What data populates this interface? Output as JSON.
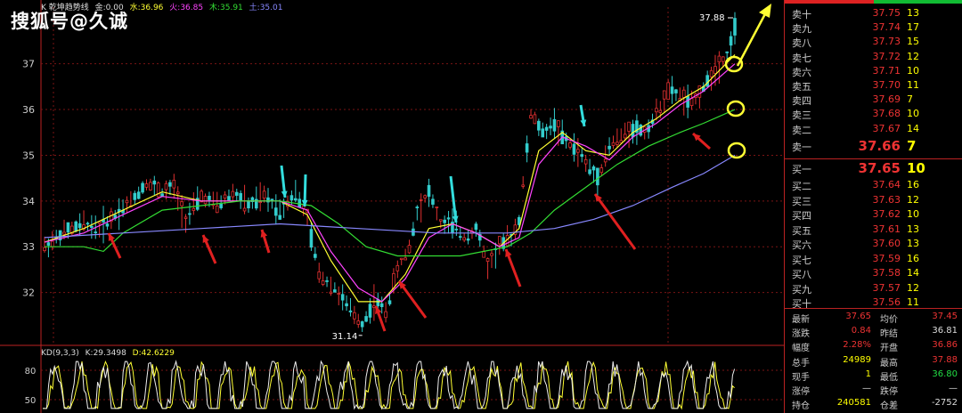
{
  "watermark": "搜狐号@久诚",
  "legend": {
    "title": "K 乾坤趋势线",
    "items": [
      {
        "text": "金:0.00",
        "color": "#dddddd"
      },
      {
        "text": "水:36.96",
        "color": "#ffff33"
      },
      {
        "text": "火:36.85",
        "color": "#ff44ff"
      },
      {
        "text": "木:35.91",
        "color": "#33dd33"
      },
      {
        "text": "土:35.01",
        "color": "#8888ff"
      }
    ]
  },
  "kd": {
    "title": "KD(9,3,3)",
    "k": "K:29.3498",
    "d": "D:42.6229"
  },
  "chart_data": {
    "type": "line",
    "title": "乾坤趋势线",
    "ylim": [
      31.0,
      38.2
    ],
    "yticks": [
      32,
      33,
      34,
      35,
      36,
      37
    ],
    "high_label": "37.88",
    "low_label": "31.14",
    "price": [
      [
        0,
        33.0
      ],
      [
        5,
        33.3
      ],
      [
        10,
        33.5
      ],
      [
        14,
        33.4
      ],
      [
        18,
        33.7
      ],
      [
        22,
        34.0
      ],
      [
        26,
        34.4
      ],
      [
        30,
        34.2
      ],
      [
        33,
        34.3
      ],
      [
        36,
        33.6
      ],
      [
        40,
        34.1
      ],
      [
        44,
        33.9
      ],
      [
        48,
        34.2
      ],
      [
        52,
        33.9
      ],
      [
        56,
        34.1
      ],
      [
        60,
        33.8
      ],
      [
        64,
        34.2
      ],
      [
        67,
        33.6
      ],
      [
        70,
        32.4
      ],
      [
        74,
        32.1
      ],
      [
        78,
        31.6
      ],
      [
        81,
        31.3
      ],
      [
        84,
        31.8
      ],
      [
        87,
        31.6
      ],
      [
        90,
        32.5
      ],
      [
        93,
        33.0
      ],
      [
        95,
        33.8
      ],
      [
        98,
        34.2
      ],
      [
        101,
        33.5
      ],
      [
        104,
        33.5
      ],
      [
        107,
        33.2
      ],
      [
        110,
        33.4
      ],
      [
        113,
        32.6
      ],
      [
        116,
        33.0
      ],
      [
        119,
        33.2
      ],
      [
        121,
        33.6
      ],
      [
        124,
        35.9
      ],
      [
        127,
        35.5
      ],
      [
        130,
        35.7
      ],
      [
        133,
        35.3
      ],
      [
        136,
        35.1
      ],
      [
        139,
        34.7
      ],
      [
        141,
        34.5
      ],
      [
        144,
        35.2
      ],
      [
        147,
        35.4
      ],
      [
        150,
        35.6
      ],
      [
        153,
        35.5
      ],
      [
        156,
        35.9
      ],
      [
        159,
        36.4
      ],
      [
        162,
        36.3
      ],
      [
        165,
        36.1
      ],
      [
        168,
        36.5
      ],
      [
        171,
        36.9
      ],
      [
        174,
        37.2
      ],
      [
        176,
        37.8
      ]
    ],
    "series": [
      {
        "name": "水",
        "color": "#ffff33",
        "values": [
          [
            0,
            33.1
          ],
          [
            10,
            33.4
          ],
          [
            20,
            33.8
          ],
          [
            30,
            34.2
          ],
          [
            40,
            34.0
          ],
          [
            50,
            34.0
          ],
          [
            60,
            34.0
          ],
          [
            67,
            33.7
          ],
          [
            73,
            32.7
          ],
          [
            80,
            31.8
          ],
          [
            86,
            31.8
          ],
          [
            92,
            32.4
          ],
          [
            98,
            33.4
          ],
          [
            104,
            33.5
          ],
          [
            110,
            33.3
          ],
          [
            116,
            33.0
          ],
          [
            121,
            33.4
          ],
          [
            126,
            35.1
          ],
          [
            132,
            35.5
          ],
          [
            138,
            35.1
          ],
          [
            144,
            35.0
          ],
          [
            150,
            35.5
          ],
          [
            156,
            35.8
          ],
          [
            162,
            36.2
          ],
          [
            168,
            36.5
          ],
          [
            176,
            37.2
          ]
        ]
      },
      {
        "name": "火",
        "color": "#ff44ff",
        "values": [
          [
            0,
            33.1
          ],
          [
            10,
            33.3
          ],
          [
            20,
            33.7
          ],
          [
            30,
            34.1
          ],
          [
            40,
            34.0
          ],
          [
            50,
            34.0
          ],
          [
            60,
            34.0
          ],
          [
            67,
            33.8
          ],
          [
            73,
            32.9
          ],
          [
            80,
            32.1
          ],
          [
            86,
            31.8
          ],
          [
            92,
            32.3
          ],
          [
            98,
            33.2
          ],
          [
            104,
            33.5
          ],
          [
            110,
            33.3
          ],
          [
            116,
            33.0
          ],
          [
            121,
            33.2
          ],
          [
            126,
            34.8
          ],
          [
            132,
            35.4
          ],
          [
            138,
            35.2
          ],
          [
            144,
            34.9
          ],
          [
            150,
            35.4
          ],
          [
            156,
            35.7
          ],
          [
            162,
            36.1
          ],
          [
            168,
            36.4
          ],
          [
            176,
            37.0
          ]
        ]
      },
      {
        "name": "木",
        "color": "#33dd33",
        "values": [
          [
            0,
            33.0
          ],
          [
            10,
            33.0
          ],
          [
            15,
            32.9
          ],
          [
            20,
            33.3
          ],
          [
            30,
            33.8
          ],
          [
            40,
            33.9
          ],
          [
            50,
            34.0
          ],
          [
            60,
            34.0
          ],
          [
            68,
            33.9
          ],
          [
            75,
            33.5
          ],
          [
            82,
            33.0
          ],
          [
            90,
            32.8
          ],
          [
            98,
            32.8
          ],
          [
            106,
            32.8
          ],
          [
            112,
            32.9
          ],
          [
            118,
            33.0
          ],
          [
            124,
            33.3
          ],
          [
            130,
            33.8
          ],
          [
            138,
            34.3
          ],
          [
            146,
            34.8
          ],
          [
            154,
            35.2
          ],
          [
            162,
            35.5
          ],
          [
            168,
            35.7
          ],
          [
            176,
            36.0
          ]
        ]
      },
      {
        "name": "土",
        "color": "#8888ff",
        "values": [
          [
            0,
            33.2
          ],
          [
            20,
            33.3
          ],
          [
            40,
            33.4
          ],
          [
            60,
            33.5
          ],
          [
            80,
            33.4
          ],
          [
            100,
            33.3
          ],
          [
            118,
            33.3
          ],
          [
            130,
            33.4
          ],
          [
            140,
            33.6
          ],
          [
            150,
            33.9
          ],
          [
            160,
            34.3
          ],
          [
            168,
            34.6
          ],
          [
            176,
            35.0
          ]
        ]
      }
    ],
    "kd_ylim": [
      40,
      90
    ],
    "kd_yticks": [
      50,
      80
    ]
  },
  "orderbook": {
    "asks": [
      {
        "label": "卖十",
        "price": "37.75",
        "vol": "13"
      },
      {
        "label": "卖九",
        "price": "37.74",
        "vol": "17"
      },
      {
        "label": "卖八",
        "price": "37.73",
        "vol": "15"
      },
      {
        "label": "卖七",
        "price": "37.72",
        "vol": "12"
      },
      {
        "label": "卖六",
        "price": "37.71",
        "vol": "10"
      },
      {
        "label": "卖五",
        "price": "37.70",
        "vol": "11"
      },
      {
        "label": "卖四",
        "price": "37.69",
        "vol": "7"
      },
      {
        "label": "卖三",
        "price": "37.68",
        "vol": "10"
      },
      {
        "label": "卖二",
        "price": "37.67",
        "vol": "14"
      },
      {
        "label": "卖一",
        "price": "37.66",
        "vol": "7"
      }
    ],
    "bids": [
      {
        "label": "买一",
        "price": "37.65",
        "vol": "10"
      },
      {
        "label": "买二",
        "price": "37.64",
        "vol": "16"
      },
      {
        "label": "买三",
        "price": "37.63",
        "vol": "12"
      },
      {
        "label": "买四",
        "price": "37.62",
        "vol": "10"
      },
      {
        "label": "买五",
        "price": "37.61",
        "vol": "13"
      },
      {
        "label": "买六",
        "price": "37.60",
        "vol": "13"
      },
      {
        "label": "买七",
        "price": "37.59",
        "vol": "16"
      },
      {
        "label": "买八",
        "price": "37.58",
        "vol": "14"
      },
      {
        "label": "买九",
        "price": "37.57",
        "vol": "12"
      },
      {
        "label": "买十",
        "price": "37.56",
        "vol": "11"
      }
    ]
  },
  "stats": [
    {
      "l1": "最新",
      "v1": "37.65",
      "c1": "red",
      "l2": "均价",
      "v2": "37.45",
      "c2": "red"
    },
    {
      "l1": "涨跌",
      "v1": "0.84",
      "c1": "red",
      "l2": "昨结",
      "v2": "36.81",
      "c2": "wht"
    },
    {
      "l1": "幅度",
      "v1": "2.28%",
      "c1": "red",
      "l2": "开盘",
      "v2": "36.86",
      "c2": "red"
    },
    {
      "l1": "总手",
      "v1": "24989",
      "c1": "yel",
      "l2": "最高",
      "v2": "37.88",
      "c2": "red"
    },
    {
      "l1": "现手",
      "v1": "1",
      "c1": "yel",
      "l2": "最低",
      "v2": "36.80",
      "c2": "grn"
    },
    {
      "l1": "涨停",
      "v1": "—",
      "c1": "wht",
      "l2": "跌停",
      "v2": "—",
      "c2": "wht"
    },
    {
      "l1": "持仓",
      "v1": "240581",
      "c1": "yel",
      "l2": "仓差",
      "v2": "-2752",
      "c2": "wht"
    }
  ]
}
